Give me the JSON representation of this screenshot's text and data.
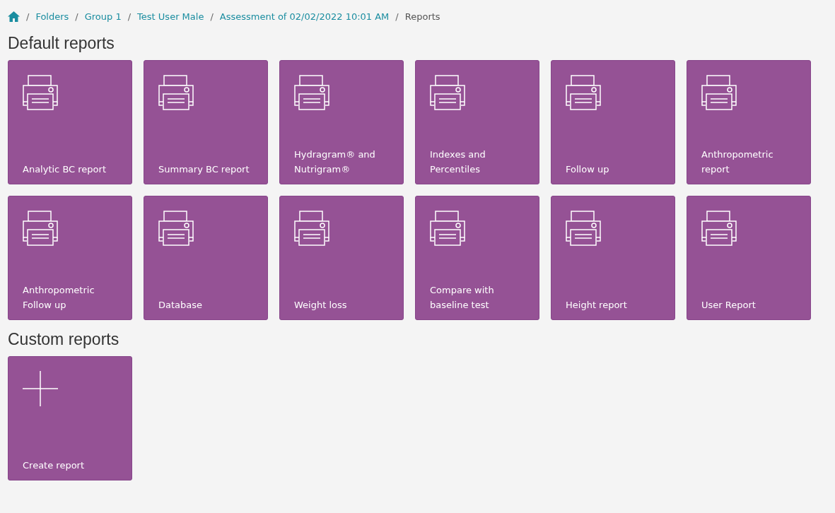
{
  "breadcrumb": [
    {
      "separator": "/",
      "label": "Folders",
      "kind": "link"
    },
    {
      "separator": "/",
      "label": "Group 1",
      "kind": "link"
    },
    {
      "separator": "/",
      "label": "Test User Male",
      "kind": "link"
    },
    {
      "separator": "/",
      "label": "Assessment of 02/02/2022 10:01 AM",
      "kind": "link"
    },
    {
      "separator": "/",
      "label": "Reports",
      "kind": "current"
    }
  ],
  "sections": [
    {
      "title": "Default reports",
      "tiles": [
        {
          "kind": "report",
          "lines": [
            "Analytic BC report"
          ]
        },
        {
          "kind": "report",
          "lines": [
            "Summary BC report"
          ]
        },
        {
          "kind": "report",
          "lines": [
            "Hydragram® and",
            "Nutrigram®"
          ]
        },
        {
          "kind": "report",
          "lines": [
            "Indexes and",
            "Percentiles"
          ]
        },
        {
          "kind": "report",
          "lines": [
            "Follow up"
          ]
        },
        {
          "kind": "report",
          "lines": [
            "Anthropometric",
            "report"
          ]
        },
        {
          "kind": "report",
          "lines": [
            "Anthropometric",
            "Follow up"
          ]
        },
        {
          "kind": "report",
          "lines": [
            "Database"
          ]
        },
        {
          "kind": "report",
          "lines": [
            "Weight loss"
          ]
        },
        {
          "kind": "report",
          "lines": [
            "Compare with",
            "baseline test"
          ]
        },
        {
          "kind": "report",
          "lines": [
            "Height report"
          ]
        },
        {
          "kind": "report",
          "lines": [
            "User Report"
          ]
        }
      ]
    },
    {
      "title": "Custom reports",
      "tiles": [
        {
          "kind": "create",
          "lines": [
            "Create report"
          ]
        }
      ]
    }
  ]
}
